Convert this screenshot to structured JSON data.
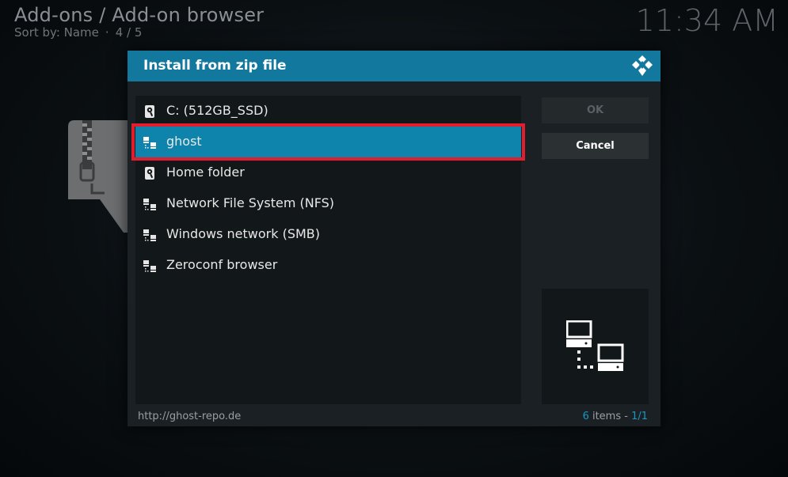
{
  "header": {
    "breadcrumb": "Add-ons / Add-on browser",
    "sort_label": "Sort by: Name",
    "separator": "·",
    "position": "4 / 5",
    "clock": "11:34 AM"
  },
  "dialog": {
    "title": "Install from zip file",
    "items": [
      {
        "label": "C: (512GB_SSD)",
        "icon": "hard-drive-icon"
      },
      {
        "label": "ghost",
        "icon": "network-icon",
        "selected": true
      },
      {
        "label": "Home folder",
        "icon": "hard-drive-icon"
      },
      {
        "label": "Network File System (NFS)",
        "icon": "network-icon"
      },
      {
        "label": "Windows network (SMB)",
        "icon": "network-icon"
      },
      {
        "label": "Zeroconf browser",
        "icon": "network-icon"
      }
    ],
    "ok_label": "OK",
    "cancel_label": "Cancel",
    "footer_path": "http://ghost-repo.de",
    "item_count": "6",
    "item_word": " items - ",
    "page": "1/1"
  },
  "colors": {
    "header_bg": "#12789e",
    "selected_bg": "#0e84ad",
    "highlight_border": "#e21d2d",
    "accent_text": "#1b95c4"
  }
}
